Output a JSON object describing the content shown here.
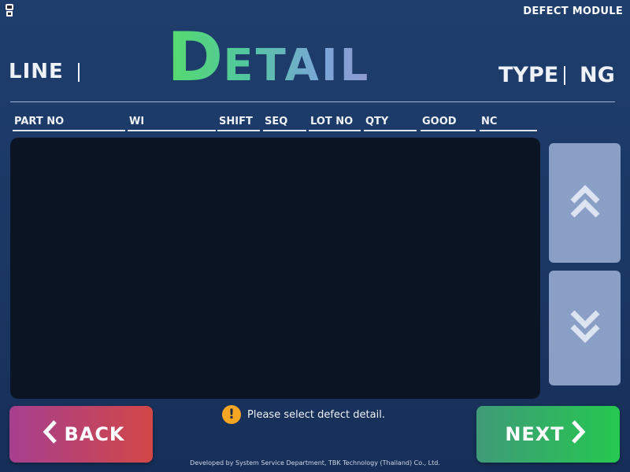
{
  "header": {
    "module_label": "DEFECT MODULE",
    "line_label": "LINE",
    "title_first": "D",
    "title_rest": "ETAIL",
    "type_label": "TYPE",
    "type_value": "NG"
  },
  "table": {
    "columns": [
      "PART NO",
      "WI",
      "SHIFT",
      "SEQ",
      "LOT NO",
      "QTY",
      "GOOD",
      "NC"
    ],
    "rows": []
  },
  "scroll": {
    "up_icon": "chevron-double-up-icon",
    "down_icon": "chevron-double-down-icon"
  },
  "actions": {
    "back_label": "BACK",
    "next_label": "NEXT"
  },
  "status": {
    "icon": "warning-icon",
    "message": "Please select defect detail."
  },
  "footer": {
    "text": "Developed by System Service Department, TBK Technology (Thailand) Co., Ltd."
  },
  "colors": {
    "background": "#1b3764",
    "list_bg": "#0b1423",
    "scroll_button": "#8a9fc6",
    "back_gradient": [
      "#a53f8f",
      "#d24747"
    ],
    "next_gradient": [
      "#3f9a78",
      "#25c84f"
    ],
    "warning": "#f5a623"
  }
}
